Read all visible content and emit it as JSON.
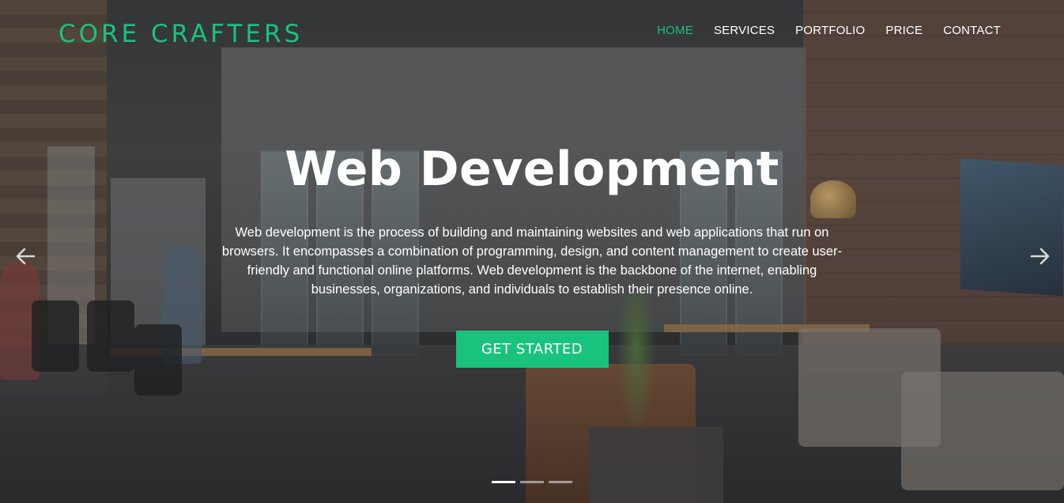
{
  "header": {
    "logo": "CORE CRAFTERS",
    "nav": [
      {
        "label": "HOME",
        "active": true
      },
      {
        "label": "SERVICES",
        "active": false
      },
      {
        "label": "PORTFOLIO",
        "active": false
      },
      {
        "label": "PRICE",
        "active": false
      },
      {
        "label": "CONTACT",
        "active": false
      }
    ]
  },
  "hero": {
    "title": "Web Development",
    "description": "Web development is the process of building and maintaining websites and web applications that run on browsers. It encompasses a combination of programming, design, and content management to create user-friendly and functional online platforms. Web development is the backbone of the internet, enabling businesses, organizations, and individuals to establish their presence online.",
    "cta_label": "GET STARTED"
  },
  "carousel": {
    "prev_icon": "arrow-left-icon",
    "next_icon": "arrow-right-icon",
    "slide_count": 3,
    "active_slide": 1
  },
  "colors": {
    "accent": "#19c37d",
    "text": "#ffffff"
  }
}
